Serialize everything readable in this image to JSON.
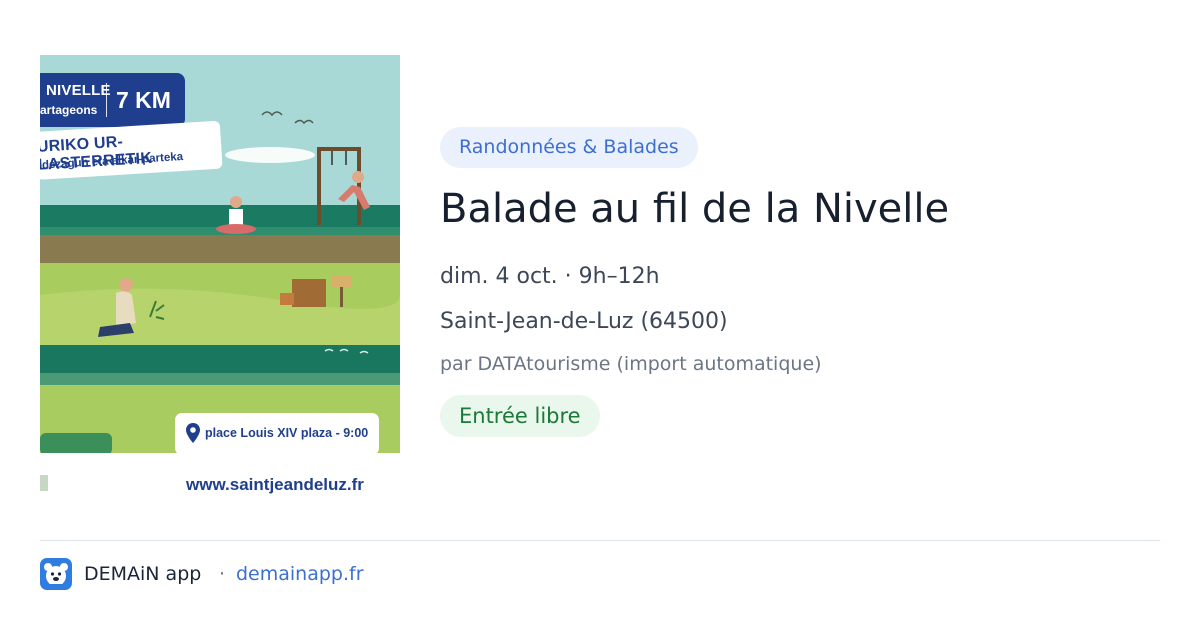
{
  "poster": {
    "title_line1": "NIVELLE",
    "title_line2": "artageons",
    "distance": "7 KM",
    "subtitle_line1": "URIKO UR-LASTERRETIK",
    "subtitle_line2": "dezagun eta elkar-parteka",
    "meeting_point": "place Louis XIV plaza - 9:00",
    "website": "www.saintjeandeluz.fr"
  },
  "event": {
    "category": "Randonnées & Balades",
    "title": "Balade au fil de la Nivelle",
    "datetime": "dim. 4 oct. · 9h–12h",
    "location": "Saint-Jean-de-Luz (64500)",
    "organizer": "par DATAtourisme (import automatique)",
    "price": "Entrée libre"
  },
  "footer": {
    "app_name": "DEMAiN app",
    "separator": "·",
    "domain": "demainapp.fr",
    "app_icon": "bear-face-icon"
  },
  "colors": {
    "category_bg": "#eaf1fd",
    "category_text": "#3d6fd1",
    "price_bg": "#e9f7ec",
    "price_text": "#1b7a37",
    "poster_blue": "#1f3f8e",
    "link": "#3d6fd1"
  }
}
